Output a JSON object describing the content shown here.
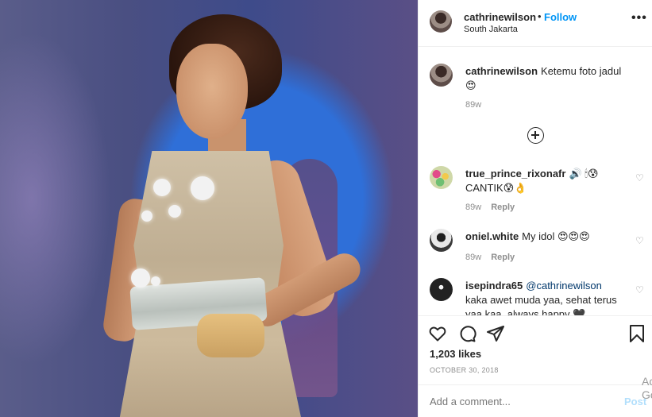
{
  "header": {
    "username": "cathrinewilson",
    "dot": "•",
    "follow": "Follow",
    "location": "South Jakarta",
    "more": "•••"
  },
  "caption": {
    "username": "cathrinewilson",
    "text": "Ketemu foto jadul",
    "emoji": "😍",
    "time": "89w"
  },
  "comments": [
    {
      "username": "true_prince_rixonafr",
      "text": "🔊 🕯😰 CANTIK😰👌",
      "time": "89w",
      "reply": "Reply"
    },
    {
      "username": "oniel.white",
      "text": "My idol 😍😍😍",
      "time": "89w",
      "reply": "Reply"
    },
    {
      "username": "isepindra65",
      "mention": "@cathrinewilson",
      "text": "kaka awet muda yaa, sehat terus yaa kaa, always happy 🖤"
    }
  ],
  "likes": "1,203 likes",
  "date": "OCTOBER 30, 2018",
  "add_comment": {
    "placeholder": "Add a comment...",
    "post": "Post"
  },
  "watermark": {
    "line1": "Ac",
    "line2": "Go"
  }
}
